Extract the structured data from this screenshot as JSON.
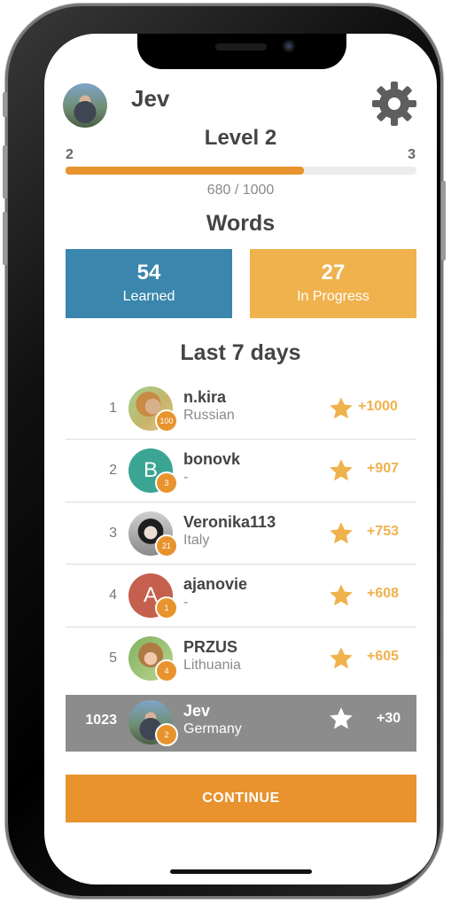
{
  "profile": {
    "name": "Jev"
  },
  "level": {
    "title": "Level 2",
    "from": "2",
    "to": "3",
    "progress_text": "680 / 1000",
    "progress_fraction": 0.68
  },
  "words": {
    "title": "Words",
    "learned": {
      "count": "54",
      "label": "Learned"
    },
    "in_progress": {
      "count": "27",
      "label": "In Progress"
    }
  },
  "leaderboard": {
    "title": "Last 7 days",
    "rows": [
      {
        "rank": "1",
        "name": "n.kira",
        "sub": "Russian",
        "badge": "100",
        "score": "+1000"
      },
      {
        "rank": "2",
        "name": "bonovk",
        "sub": "-",
        "badge": "3",
        "score": "+907",
        "letter": "B"
      },
      {
        "rank": "3",
        "name": "Veronika113",
        "sub": "Italy",
        "badge": "21",
        "score": "+753"
      },
      {
        "rank": "4",
        "name": "ajanovie",
        "sub": "-",
        "badge": "1",
        "score": "+608",
        "letter": "A"
      },
      {
        "rank": "5",
        "name": "PRZUS",
        "sub": "Lithuania",
        "badge": "4",
        "score": "+605"
      }
    ],
    "me": {
      "rank": "1023",
      "name": "Jev",
      "sub": "Germany",
      "badge": "2",
      "score": "+30"
    }
  },
  "continue_label": "CONTINUE",
  "colors": {
    "orange": "#e8932d",
    "blue": "#3a86ad",
    "light_orange": "#f0b24d",
    "gray_row": "#8c8c8c"
  },
  "icons": {
    "settings": "gear-icon",
    "star": "star-icon"
  }
}
